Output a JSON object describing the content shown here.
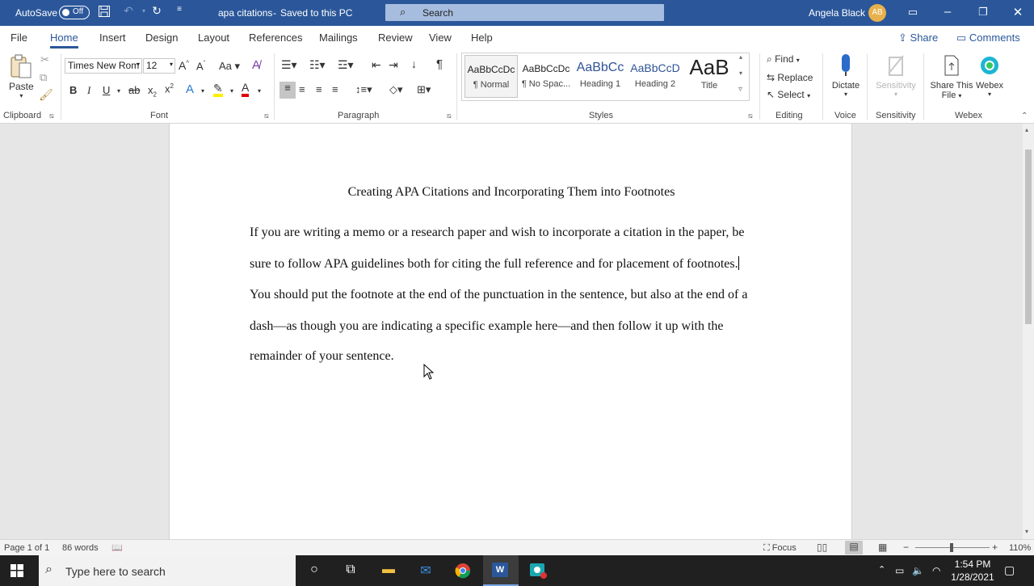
{
  "titlebar": {
    "autosave_label": "AutoSave",
    "autosave_state": "Off",
    "doc_title": "apa citations",
    "save_status": "Saved to this PC",
    "search_placeholder": "Search",
    "user_name": "Angela Black",
    "user_initials": "AB",
    "accent": "#2b579a"
  },
  "tabs": [
    "File",
    "Home",
    "Insert",
    "Design",
    "Layout",
    "References",
    "Mailings",
    "Review",
    "View",
    "Help"
  ],
  "active_tab": "Home",
  "share_label": "Share",
  "comments_label": "Comments",
  "ribbon": {
    "clipboard": {
      "paste_label": "Paste",
      "group_label": "Clipboard"
    },
    "font": {
      "font_name": "Times New Rom",
      "font_size": "12",
      "group_label": "Font"
    },
    "paragraph": {
      "group_label": "Paragraph"
    },
    "styles": {
      "group_label": "Styles",
      "items": [
        {
          "preview": "AaBbCcDc",
          "name": "¶ Normal"
        },
        {
          "preview": "AaBbCcDc",
          "name": "¶ No Spac..."
        },
        {
          "preview": "AaBbCc",
          "name": "Heading 1"
        },
        {
          "preview": "AaBbCcD",
          "name": "Heading 2"
        },
        {
          "preview": "AaB",
          "name": "Title"
        }
      ]
    },
    "editing": {
      "find": "Find",
      "replace": "Replace",
      "select": "Select",
      "group_label": "Editing"
    },
    "voice": {
      "dictate": "Dictate",
      "group_label": "Voice"
    },
    "sensitivity": {
      "label": "Sensitivity",
      "group_label": "Sensitivity"
    },
    "webex": {
      "share_line1": "Share This",
      "share_line2": "File",
      "webex": "Webex",
      "group_label": "Webex"
    }
  },
  "document": {
    "title": "Creating APA Citations and Incorporating Them into Footnotes",
    "lines": [
      "If you are writing a memo or a research paper and wish to incorporate a citation in the paper, be",
      "sure to follow APA guidelines both for citing the full reference and for placement of footnotes.",
      "You should put the footnote at the end of the punctuation in the sentence, but also at the end of a",
      "dash—as though you are indicating a specific example here—and then follow it up with the",
      "remainder of your sentence."
    ]
  },
  "status": {
    "page": "Page 1 of 1",
    "words": "86 words",
    "focus": "Focus",
    "zoom": "110%"
  },
  "taskbar": {
    "search_placeholder": "Type here to search",
    "time": "1:54 PM",
    "date": "1/28/2021"
  }
}
